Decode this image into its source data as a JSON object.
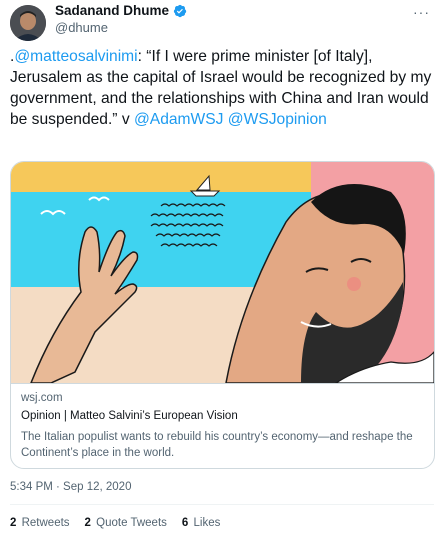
{
  "author": {
    "name": "Sadanand Dhume",
    "handle": "@dhume",
    "verified_icon": "verified-badge-icon",
    "badge_color": "#1d9bf0"
  },
  "more_label": "···",
  "tweet": {
    "prefix": ".",
    "mention": "@matteosalvinimi",
    "body": ": “If I were prime minister [of Italy], Jerusalem as the capital of Israel would be recognized by my government, and the relationships with China and Iran would be suspended.” v ",
    "mention2": "@AdamWSJ",
    "mention3": "@WSJopinion"
  },
  "card": {
    "domain": "wsj.com",
    "title": "Opinion | Matteo Salvini’s European Vision",
    "description": "The Italian populist wants to rebuild his country’s economy—and reshape the Continent’s place in the world."
  },
  "timestamp": "5:34 PM · Sep 12, 2020",
  "stats": {
    "retweets_count": "2",
    "retweets_label": "Retweets",
    "quotes_count": "2",
    "quotes_label": "Quote Tweets",
    "likes_count": "6",
    "likes_label": "Likes"
  },
  "colors": {
    "link": "#1d9bf0",
    "text": "#0f1419",
    "secondary": "#536471"
  }
}
